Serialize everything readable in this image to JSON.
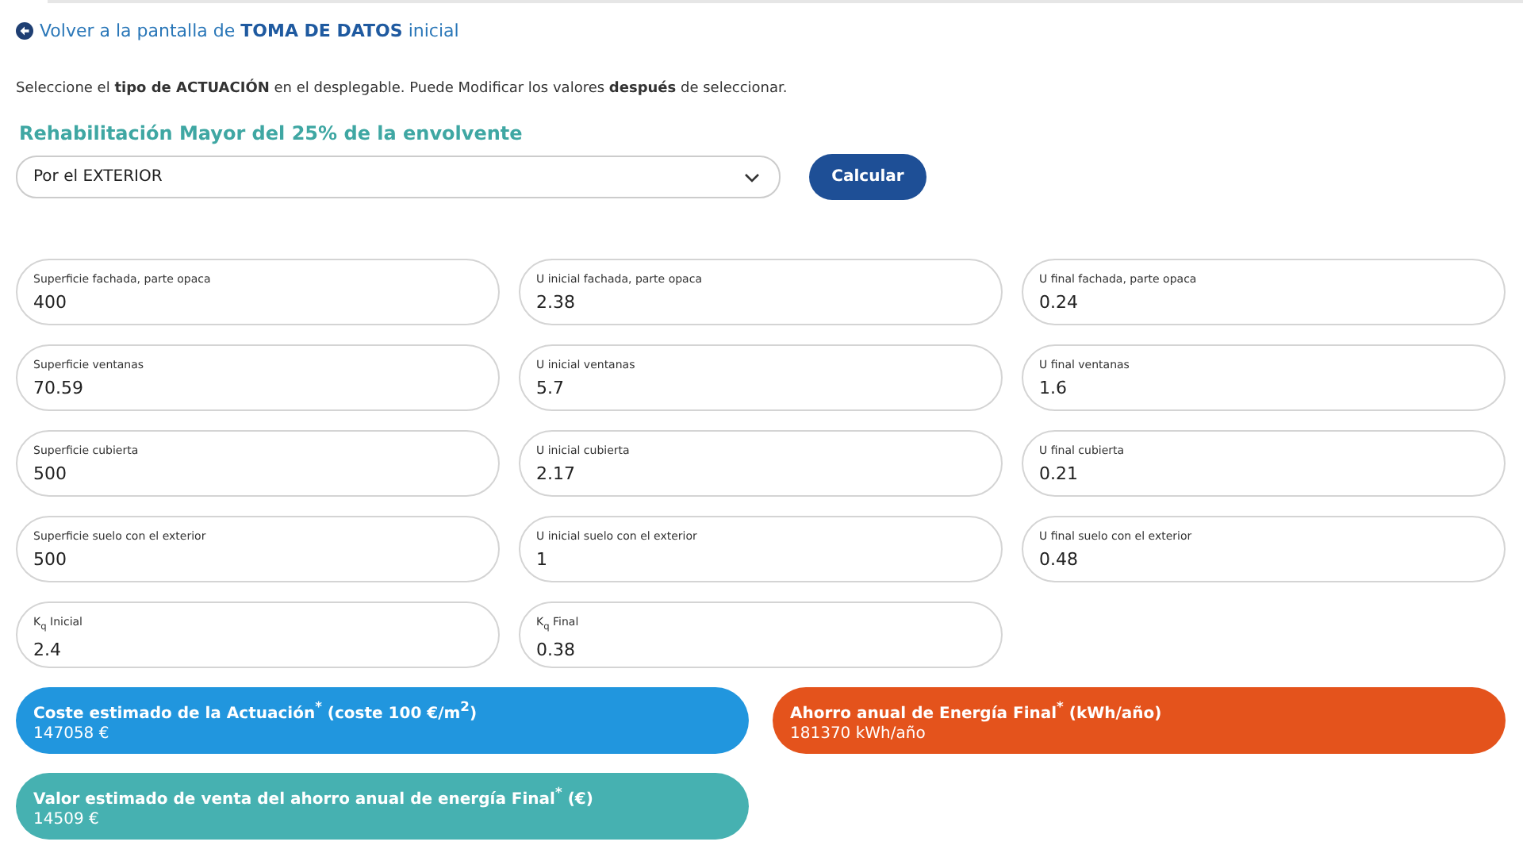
{
  "back_link": "Volver a la pantalla de **TOMA DE DATOS** inicial",
  "instructions": "Seleccione el **tipo de ACTUACIÓN** en el desplegable. Puede Modificar los valores **después** de seleccionar.",
  "section_title": "Rehabilitación Mayor del 25% de la envolvente",
  "dropdown": {
    "value": "Por el EXTERIOR"
  },
  "calculate_button": "Calcular",
  "fields": [
    {
      "label": "Superficie fachada, parte opaca",
      "value": "400"
    },
    {
      "label": "U inicial fachada, parte opaca",
      "value": "2.38"
    },
    {
      "label": "U final fachada, parte opaca",
      "value": "0.24"
    },
    {
      "label": "Superficie ventanas",
      "value": "70.59"
    },
    {
      "label": "U inicial ventanas",
      "value": "5.7"
    },
    {
      "label": "U final ventanas",
      "value": "1.6"
    },
    {
      "label": "Superficie cubierta",
      "value": "500"
    },
    {
      "label": "U inicial cubierta",
      "value": "2.17"
    },
    {
      "label": "U final cubierta",
      "value": "0.21"
    },
    {
      "label": "Superficie suelo con el exterior",
      "value": "500"
    },
    {
      "label": "U inicial suelo con el exterior",
      "value": "1"
    },
    {
      "label": "U final suelo con el exterior",
      "value": "0.48"
    },
    {
      "label": "K$_{q}$ Inicial",
      "value": "2.4"
    },
    {
      "label": "K$_{q}$ Final",
      "value": "0.38"
    }
  ],
  "results": [
    {
      "title": "Coste estimado de la Actuación$^{*}$ (coste 100 €/m$^{2}$)",
      "value": "147058 €",
      "color": "#2196de"
    },
    {
      "title": "Ahorro anual de Energía Final$^{*}$ (kWh/año)",
      "value": "181370 kWh/año",
      "color": "#e4531c"
    },
    {
      "title": "Valor estimado de venta del ahorro anual de energía Final$^{*}$ (€)",
      "value": "14509 €",
      "color": "#46b1b1"
    }
  ]
}
